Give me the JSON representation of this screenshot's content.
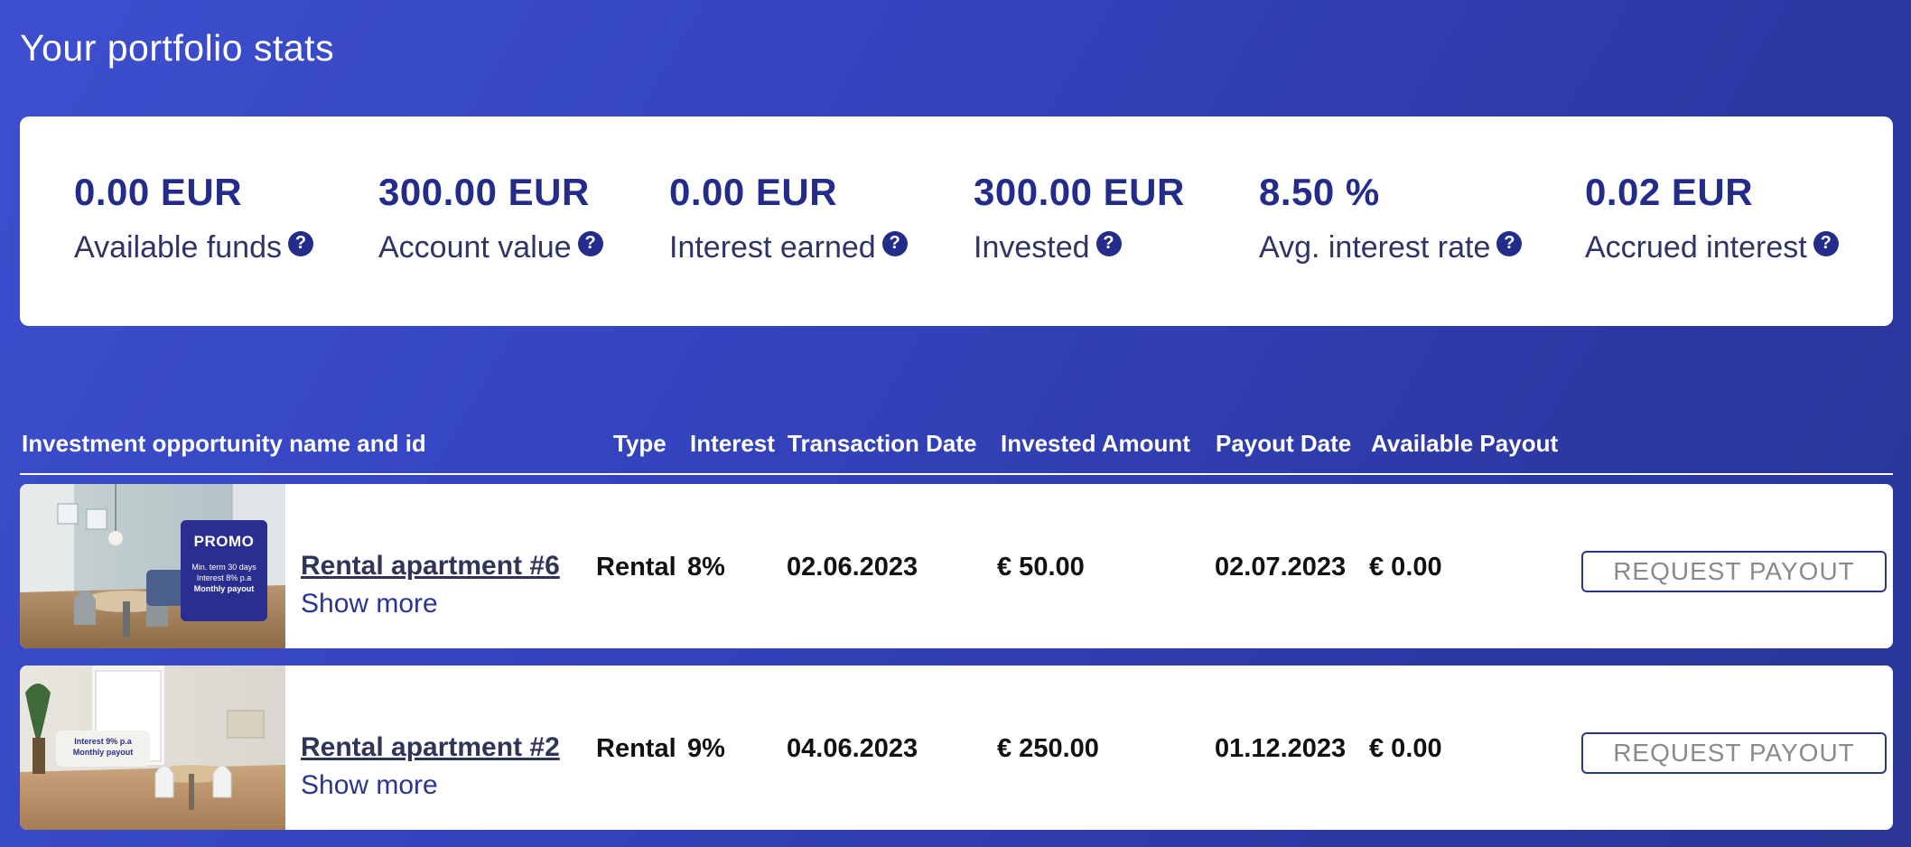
{
  "page_title": "Your portfolio stats",
  "stats": [
    {
      "value": "0.00 EUR",
      "label": "Available funds"
    },
    {
      "value": "300.00 EUR",
      "label": "Account value"
    },
    {
      "value": "0.00 EUR",
      "label": "Interest earned"
    },
    {
      "value": "300.00 EUR",
      "label": "Invested"
    },
    {
      "value": "8.50 %",
      "label": "Avg. interest rate"
    },
    {
      "value": "0.02 EUR",
      "label": "Accrued interest"
    }
  ],
  "help_glyph": "?",
  "table": {
    "headers": {
      "name": "Investment opportunity name and id",
      "type": "Type",
      "interest": "Interest",
      "transaction_date": "Transaction Date",
      "invested_amount": "Invested Amount",
      "payout_date": "Payout Date",
      "available_payout": "Available Payout"
    },
    "rows": [
      {
        "name": "Rental apartment #6",
        "show_more": "Show more",
        "type": "Rental",
        "interest": "8%",
        "transaction_date": "02.06.2023",
        "invested_amount": "€ 50.00",
        "payout_date": "02.07.2023",
        "available_payout": "€ 0.00",
        "action": "REQUEST PAYOUT",
        "badge": {
          "title": "PROMO",
          "line1": "Min. term 30 days",
          "line2": "Interest 8% p.a",
          "line3": "Monthly payout"
        }
      },
      {
        "name": "Rental apartment #2",
        "show_more": "Show more",
        "type": "Rental",
        "interest": "9%",
        "transaction_date": "04.06.2023",
        "invested_amount": "€ 250.00",
        "payout_date": "01.12.2023",
        "available_payout": "€ 0.00",
        "action": "REQUEST PAYOUT",
        "badge": {
          "line1": "Interest 9% p.a",
          "line2": "Monthly payout"
        }
      }
    ]
  },
  "colors": {
    "background": "#3545c0",
    "accent": "#232c8a",
    "card": "#ffffff"
  }
}
